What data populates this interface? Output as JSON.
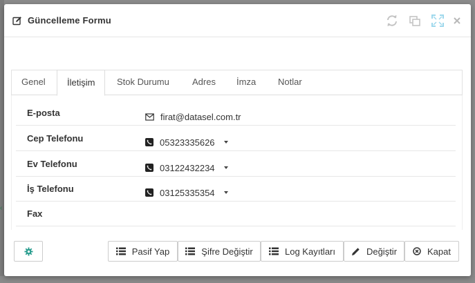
{
  "header": {
    "title": "Güncelleme Formu",
    "icons": [
      "edit-icon",
      "refresh-icon",
      "restore-icon",
      "fullscreen-icon",
      "close-icon"
    ]
  },
  "tabs": [
    {
      "label": "Genel"
    },
    {
      "label": "İletişim",
      "active": true
    },
    {
      "label": "Stok Durumu"
    },
    {
      "label": "Adres"
    },
    {
      "label": "İmza"
    },
    {
      "label": "Notlar"
    }
  ],
  "contact": {
    "email": {
      "label": "E-posta",
      "value": "firat@datasel.com.tr",
      "icon": "envelope-icon"
    },
    "mobile": {
      "label": "Cep Telefonu",
      "value": "05323335626",
      "icon": "phone-icon"
    },
    "home": {
      "label": "Ev Telefonu",
      "value": "03122432234",
      "icon": "phone-icon"
    },
    "work": {
      "label": "İş Telefonu",
      "value": "03125335354",
      "icon": "phone-icon"
    },
    "fax": {
      "label": "Fax",
      "value": ""
    }
  },
  "footer": {
    "settings_icon": "gear-icon",
    "deactivate_label": "Pasif Yap",
    "change_password_label": "Şifre Değiştir",
    "logs_label": "Log Kayıtları",
    "edit_label": "Değiştir",
    "close_label": "Kapat"
  },
  "colors": {
    "accent_teal": "#2a9d8f",
    "header_icons": "#c8c8c8",
    "fullscreen_icon": "#9ed8ec"
  }
}
